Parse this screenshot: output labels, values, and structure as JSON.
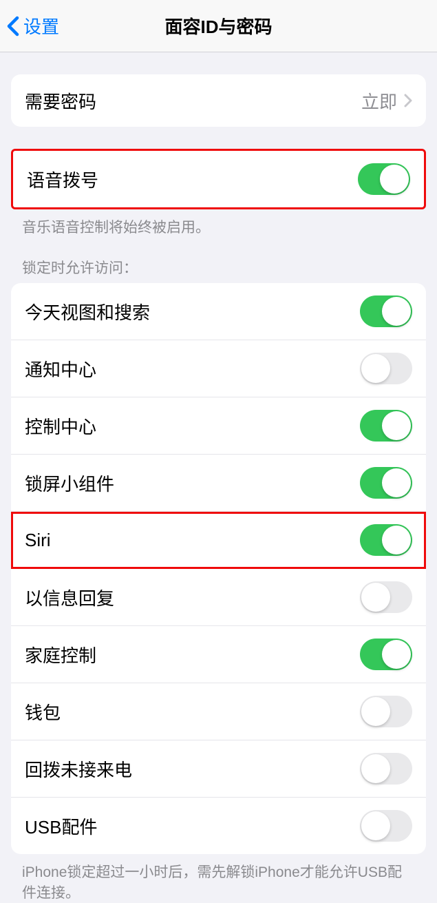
{
  "nav": {
    "back_label": "设置",
    "title": "面容ID与密码"
  },
  "passcode_group": {
    "require_passcode": {
      "label": "需要密码",
      "value": "立即"
    }
  },
  "voice_dial": {
    "label": "语音拨号",
    "on": true,
    "footer": "音乐语音控制将始终被启用。"
  },
  "lock_access": {
    "header": "锁定时允许访问：",
    "items": [
      {
        "label": "今天视图和搜索",
        "on": true,
        "highlighted": false
      },
      {
        "label": "通知中心",
        "on": false,
        "highlighted": false
      },
      {
        "label": "控制中心",
        "on": true,
        "highlighted": false
      },
      {
        "label": "锁屏小组件",
        "on": true,
        "highlighted": false
      },
      {
        "label": "Siri",
        "on": true,
        "highlighted": true
      },
      {
        "label": "以信息回复",
        "on": false,
        "highlighted": false
      },
      {
        "label": "家庭控制",
        "on": true,
        "highlighted": false
      },
      {
        "label": "钱包",
        "on": false,
        "highlighted": false
      },
      {
        "label": "回拨未接来电",
        "on": false,
        "highlighted": false
      },
      {
        "label": "USB配件",
        "on": false,
        "highlighted": false
      }
    ],
    "footer": "iPhone锁定超过一小时后，需先解锁iPhone才能允许USB配件连接。"
  }
}
